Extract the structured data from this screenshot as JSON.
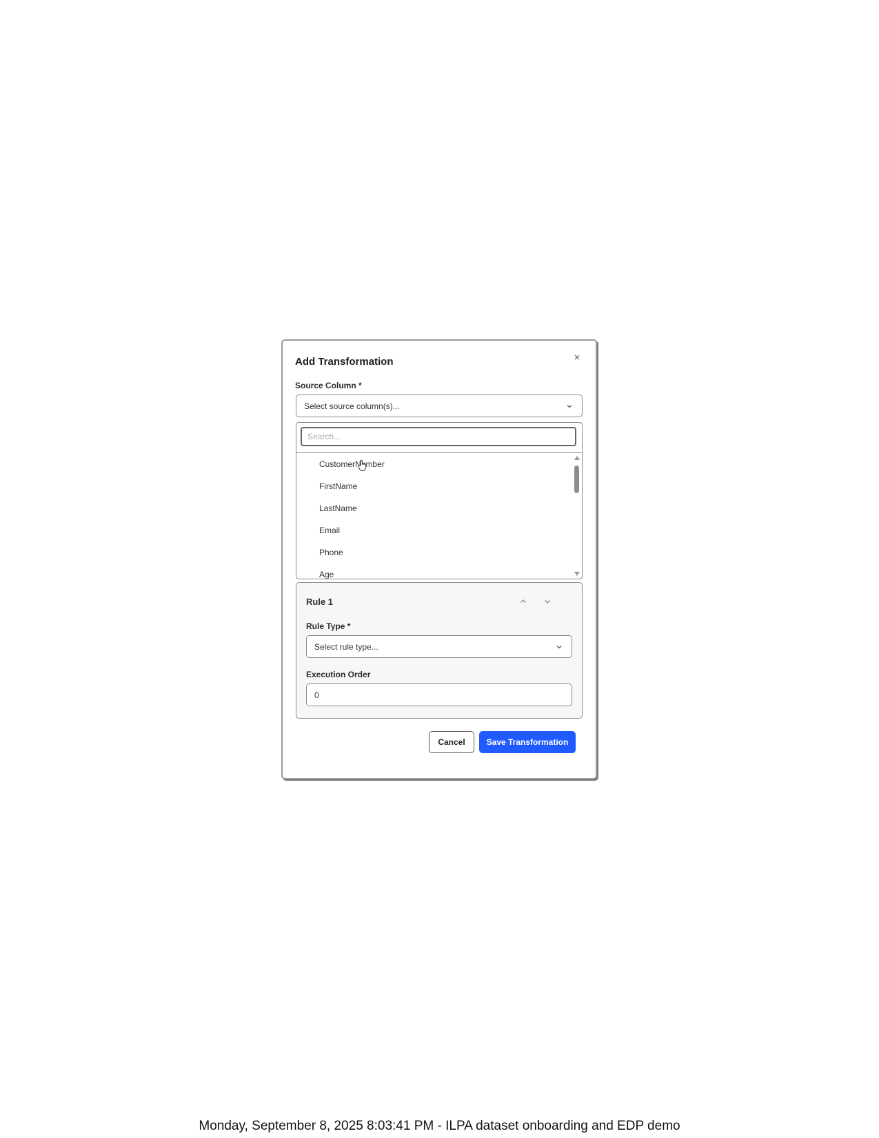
{
  "dialog": {
    "title": "Add Transformation",
    "close_glyph": "×",
    "source_column": {
      "label": "Source Column *",
      "placeholder": "Select source column(s)...",
      "search_placeholder": "Search...",
      "options": [
        "CustomerNumber",
        "FirstName",
        "LastName",
        "Email",
        "Phone",
        "Age"
      ]
    },
    "rule": {
      "title": "Rule 1",
      "rule_type_label": "Rule Type *",
      "rule_type_placeholder": "Select rule type...",
      "execution_order_label": "Execution Order",
      "execution_order_value": "0"
    },
    "buttons": {
      "cancel": "Cancel",
      "save": "Save Transformation"
    }
  },
  "footer": {
    "caption": "Monday, September 8, 2025 8:03:41 PM - ILPA dataset onboarding and EDP demo"
  },
  "colors": {
    "primary": "#1f5bff",
    "border": "#8a8a8a",
    "card_bg": "#f7f7f7"
  }
}
